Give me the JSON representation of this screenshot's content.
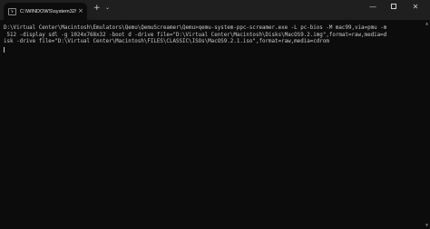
{
  "tab": {
    "title": "C:\\WINDOWS\\system32\\cmd.e",
    "close_glyph": "×",
    "icon": "terminal-icon"
  },
  "titlebar": {
    "new_tab_glyph": "+",
    "dropdown_glyph": "⌄",
    "minimize_glyph": "—",
    "close_glyph": "✕"
  },
  "terminal": {
    "lines": [
      "D:\\Virtual Center\\Macintosh\\Emulators\\Qemu\\QemuScreamer\\Qemu>qemu-system-ppc-screamer.exe -L pc-bios -M mac99,via=pmu -m",
      " 512 -display sdl -g 1024x768x32 -boot d -drive file=\"D:\\Virtual Center\\Macintosh\\Disks\\MacOS9.2.img\",format=raw,media=d",
      "isk -drive file=\"D:\\Virtual Center\\Macintosh\\FILES\\CLASSIC\\ISOs\\MacOS9.2.1.iso\",format=raw,media=cdrom"
    ]
  },
  "colors": {
    "background": "#0c0c0c",
    "titlebar": "#1f1f1f",
    "text": "#cccccc"
  }
}
